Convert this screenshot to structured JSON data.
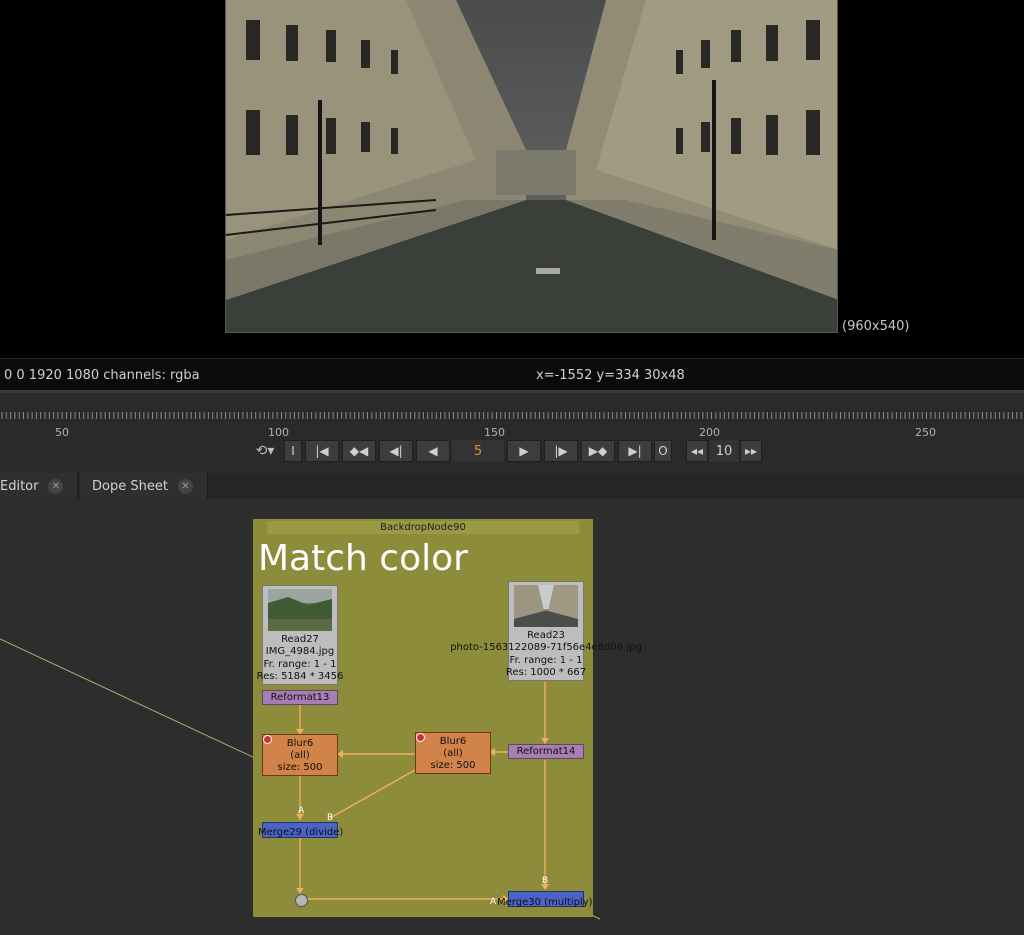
{
  "viewer": {
    "resolution_label": "(960x540)"
  },
  "infobar": {
    "left_text": "0 0 1920 1080 channels: rgba",
    "center_text": "x=-1552 y=334 30x48"
  },
  "timeline": {
    "ticks": [
      "50",
      "100",
      "150",
      "200",
      "250"
    ]
  },
  "transport": {
    "loop_icon": "loop-cycle-icon",
    "in_label": "I",
    "current_frame": "5",
    "out_label": "O",
    "step_value": "10"
  },
  "tabs": [
    {
      "label": "Editor"
    },
    {
      "label": "Dope Sheet"
    }
  ],
  "backdrop": {
    "name": "BackdropNode90",
    "title": "Match color"
  },
  "nodes": {
    "read27": {
      "name": "Read27",
      "file": "IMG_4984.jpg",
      "range": "Fr. range: 1 - 1",
      "res": "Res: 5184 * 3456"
    },
    "read23": {
      "name": "Read23",
      "file": "photo-1563122089-71f56e4e8d06.jpg",
      "range": "Fr. range: 1 - 1",
      "res": "Res: 1000 * 667"
    },
    "reformat13": {
      "label": "Reformat13"
    },
    "reformat14": {
      "label": "Reformat14"
    },
    "blur_left": {
      "name": "Blur6",
      "channels": "(all)",
      "size": "size: 500"
    },
    "blur_right": {
      "name": "Blur6",
      "channels": "(all)",
      "size": "size: 500"
    },
    "merge29": {
      "label": "Merge29 (divide)",
      "pin_a": "A",
      "pin_b": "B"
    },
    "merge30": {
      "label": "Merge30 (multiply)",
      "pin_a": "A",
      "pin_b": "B"
    }
  }
}
